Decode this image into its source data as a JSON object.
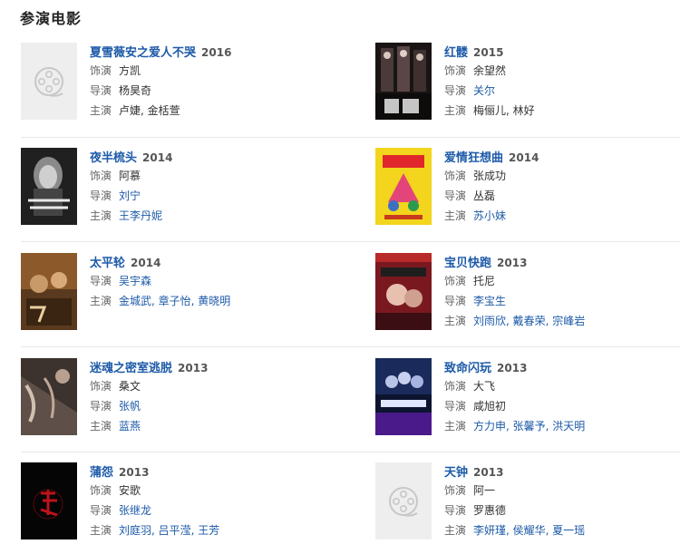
{
  "section": {
    "title": "参演电影"
  },
  "labels": {
    "role": "饰演",
    "director": "导演",
    "starring": "主演"
  },
  "movies": [
    {
      "title": "夏雪薇安之爱人不哭",
      "year": "2016",
      "role": "方凯",
      "director": "杨昊奇",
      "starring": "卢婕, 金栝萱",
      "poster": "film-reel-icon"
    },
    {
      "title": "红髅",
      "year": "2015",
      "role": "余望然",
      "director": "关尔",
      "starring": "梅俪儿, 林好",
      "poster": "red-skull-poster"
    },
    {
      "title": "夜半梳头",
      "year": "2014",
      "role": "阿慕",
      "director": "刘宁",
      "starring": "王李丹妮",
      "poster": "midnight-comb-poster"
    },
    {
      "title": "爱情狂想曲",
      "year": "2014",
      "role": "张成功",
      "director": "丛磊",
      "starring": "苏小妹",
      "poster": "love-rhapsody-poster"
    },
    {
      "title": "太平轮",
      "year": "2014",
      "role": "",
      "director": "吴宇森",
      "starring": "金城武, 章子怡, 黄晓明",
      "poster": "the-crossing-poster"
    },
    {
      "title": "宝贝快跑",
      "year": "2013",
      "role": "托尼",
      "director": "李宝生",
      "starring": "刘雨欣, 戴春荣, 宗峰岩",
      "poster": "baby-run-poster"
    },
    {
      "title": "迷魂之密室逃脱",
      "year": "2013",
      "role": "桑文",
      "director": "张帆",
      "starring": "蓝燕",
      "poster": "escape-room-poster"
    },
    {
      "title": "致命闪玩",
      "year": "2013",
      "role": "大飞",
      "director": "咸旭初",
      "starring": "方力申, 张馨予, 洪天明",
      "poster": "deadly-game-poster"
    },
    {
      "title": "蒲怨",
      "year": "2013",
      "role": "安歌",
      "director": "张继龙",
      "starring": "刘庭羽, 吕平滢, 王芳",
      "poster": "grudge-poster"
    },
    {
      "title": "天钟",
      "year": "2013",
      "role": "阿一",
      "director": "罗惠德",
      "starring": "李妍瑾, 侯耀华, 夏一瑶",
      "poster": "film-reel-icon"
    }
  ]
}
